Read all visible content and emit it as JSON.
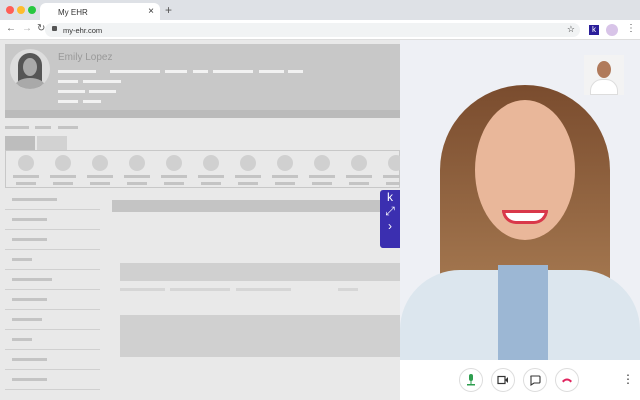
{
  "browser": {
    "tab_title": "My EHR",
    "url": "my-ehr.com",
    "close_icon": "×",
    "new_tab_icon": "+"
  },
  "patient": {
    "name": "Emily Lopez"
  },
  "sidebar_widget": {
    "logo": "k",
    "expand_icon": "⤢",
    "collapse_icon": "›"
  },
  "extension": {
    "logo": "k"
  },
  "colors": {
    "accent": "#3b2fb0",
    "hangup": "#e0245e",
    "mic": "#2e9e4f"
  }
}
